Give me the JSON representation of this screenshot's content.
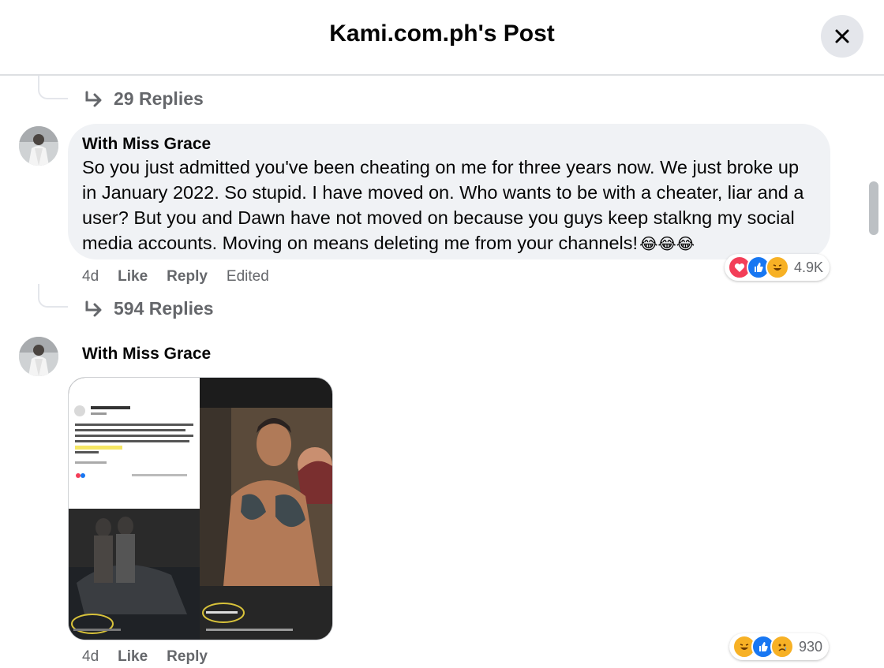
{
  "header": {
    "title": "Kami.com.ph's Post",
    "close_icon": "close-icon"
  },
  "thread": {
    "replies_top": "29 Replies",
    "replies_middle": "594 Replies"
  },
  "comments": [
    {
      "author": "With Miss Grace",
      "text": "So you just admitted you've been cheating on me for three years now. We just broke up in January 2022. So stupid. I have moved on. Who wants to be with a cheater, liar and a user? But you and Dawn have not moved on because you guys keep stalkng my social media accounts. Moving on means deleting me from your channels!",
      "text_emojis": "😂😂😂",
      "time": "4d",
      "like_label": "Like",
      "reply_label": "Reply",
      "edited_label": "Edited",
      "reaction_icons": [
        "love-icon",
        "like-icon",
        "haha-icon"
      ],
      "reaction_count": "4.9K"
    },
    {
      "author": "With Miss Grace",
      "time": "4d",
      "like_label": "Like",
      "reply_label": "Reply",
      "reaction_icons": [
        "haha-icon",
        "like-icon",
        "sad-icon"
      ],
      "reaction_count": "930"
    }
  ],
  "colors": {
    "bubble": "#f0f2f5",
    "secondary_text": "#65676b",
    "love": "#f33e58",
    "like": "#1877f2",
    "haha": "#f7b125"
  }
}
